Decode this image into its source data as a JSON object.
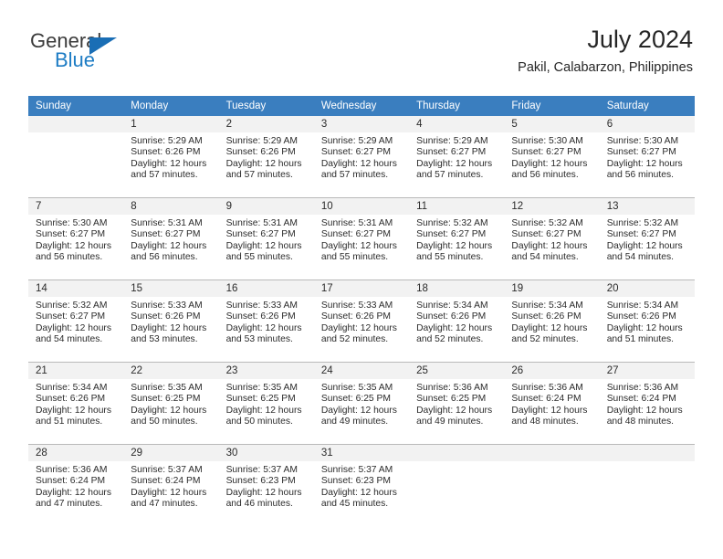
{
  "brand": {
    "line1": "General",
    "line2": "Blue",
    "flag_color": "#1a6eb5"
  },
  "header": {
    "title": "July 2024",
    "subtitle": "Pakil, Calabarzon, Philippines"
  },
  "theme": {
    "header_row_bg": "#3a7ebf",
    "daynum_bg": "#f2f2f2",
    "grid_line": "#b9b9b9",
    "text": "#2b2b2b"
  },
  "weekdays": [
    "Sunday",
    "Monday",
    "Tuesday",
    "Wednesday",
    "Thursday",
    "Friday",
    "Saturday"
  ],
  "labels": {
    "sunrise_prefix": "Sunrise:",
    "sunset_prefix": "Sunset:",
    "daylight_prefix": "Daylight:"
  },
  "weeks": [
    [
      {
        "day": "",
        "sunrise": "",
        "sunset": "",
        "daylight_line1": "",
        "daylight_line2": ""
      },
      {
        "day": "1",
        "sunrise": "Sunrise: 5:29 AM",
        "sunset": "Sunset: 6:26 PM",
        "daylight_line1": "Daylight: 12 hours",
        "daylight_line2": "and 57 minutes."
      },
      {
        "day": "2",
        "sunrise": "Sunrise: 5:29 AM",
        "sunset": "Sunset: 6:26 PM",
        "daylight_line1": "Daylight: 12 hours",
        "daylight_line2": "and 57 minutes."
      },
      {
        "day": "3",
        "sunrise": "Sunrise: 5:29 AM",
        "sunset": "Sunset: 6:27 PM",
        "daylight_line1": "Daylight: 12 hours",
        "daylight_line2": "and 57 minutes."
      },
      {
        "day": "4",
        "sunrise": "Sunrise: 5:29 AM",
        "sunset": "Sunset: 6:27 PM",
        "daylight_line1": "Daylight: 12 hours",
        "daylight_line2": "and 57 minutes."
      },
      {
        "day": "5",
        "sunrise": "Sunrise: 5:30 AM",
        "sunset": "Sunset: 6:27 PM",
        "daylight_line1": "Daylight: 12 hours",
        "daylight_line2": "and 56 minutes."
      },
      {
        "day": "6",
        "sunrise": "Sunrise: 5:30 AM",
        "sunset": "Sunset: 6:27 PM",
        "daylight_line1": "Daylight: 12 hours",
        "daylight_line2": "and 56 minutes."
      }
    ],
    [
      {
        "day": "7",
        "sunrise": "Sunrise: 5:30 AM",
        "sunset": "Sunset: 6:27 PM",
        "daylight_line1": "Daylight: 12 hours",
        "daylight_line2": "and 56 minutes."
      },
      {
        "day": "8",
        "sunrise": "Sunrise: 5:31 AM",
        "sunset": "Sunset: 6:27 PM",
        "daylight_line1": "Daylight: 12 hours",
        "daylight_line2": "and 56 minutes."
      },
      {
        "day": "9",
        "sunrise": "Sunrise: 5:31 AM",
        "sunset": "Sunset: 6:27 PM",
        "daylight_line1": "Daylight: 12 hours",
        "daylight_line2": "and 55 minutes."
      },
      {
        "day": "10",
        "sunrise": "Sunrise: 5:31 AM",
        "sunset": "Sunset: 6:27 PM",
        "daylight_line1": "Daylight: 12 hours",
        "daylight_line2": "and 55 minutes."
      },
      {
        "day": "11",
        "sunrise": "Sunrise: 5:32 AM",
        "sunset": "Sunset: 6:27 PM",
        "daylight_line1": "Daylight: 12 hours",
        "daylight_line2": "and 55 minutes."
      },
      {
        "day": "12",
        "sunrise": "Sunrise: 5:32 AM",
        "sunset": "Sunset: 6:27 PM",
        "daylight_line1": "Daylight: 12 hours",
        "daylight_line2": "and 54 minutes."
      },
      {
        "day": "13",
        "sunrise": "Sunrise: 5:32 AM",
        "sunset": "Sunset: 6:27 PM",
        "daylight_line1": "Daylight: 12 hours",
        "daylight_line2": "and 54 minutes."
      }
    ],
    [
      {
        "day": "14",
        "sunrise": "Sunrise: 5:32 AM",
        "sunset": "Sunset: 6:27 PM",
        "daylight_line1": "Daylight: 12 hours",
        "daylight_line2": "and 54 minutes."
      },
      {
        "day": "15",
        "sunrise": "Sunrise: 5:33 AM",
        "sunset": "Sunset: 6:26 PM",
        "daylight_line1": "Daylight: 12 hours",
        "daylight_line2": "and 53 minutes."
      },
      {
        "day": "16",
        "sunrise": "Sunrise: 5:33 AM",
        "sunset": "Sunset: 6:26 PM",
        "daylight_line1": "Daylight: 12 hours",
        "daylight_line2": "and 53 minutes."
      },
      {
        "day": "17",
        "sunrise": "Sunrise: 5:33 AM",
        "sunset": "Sunset: 6:26 PM",
        "daylight_line1": "Daylight: 12 hours",
        "daylight_line2": "and 52 minutes."
      },
      {
        "day": "18",
        "sunrise": "Sunrise: 5:34 AM",
        "sunset": "Sunset: 6:26 PM",
        "daylight_line1": "Daylight: 12 hours",
        "daylight_line2": "and 52 minutes."
      },
      {
        "day": "19",
        "sunrise": "Sunrise: 5:34 AM",
        "sunset": "Sunset: 6:26 PM",
        "daylight_line1": "Daylight: 12 hours",
        "daylight_line2": "and 52 minutes."
      },
      {
        "day": "20",
        "sunrise": "Sunrise: 5:34 AM",
        "sunset": "Sunset: 6:26 PM",
        "daylight_line1": "Daylight: 12 hours",
        "daylight_line2": "and 51 minutes."
      }
    ],
    [
      {
        "day": "21",
        "sunrise": "Sunrise: 5:34 AM",
        "sunset": "Sunset: 6:26 PM",
        "daylight_line1": "Daylight: 12 hours",
        "daylight_line2": "and 51 minutes."
      },
      {
        "day": "22",
        "sunrise": "Sunrise: 5:35 AM",
        "sunset": "Sunset: 6:25 PM",
        "daylight_line1": "Daylight: 12 hours",
        "daylight_line2": "and 50 minutes."
      },
      {
        "day": "23",
        "sunrise": "Sunrise: 5:35 AM",
        "sunset": "Sunset: 6:25 PM",
        "daylight_line1": "Daylight: 12 hours",
        "daylight_line2": "and 50 minutes."
      },
      {
        "day": "24",
        "sunrise": "Sunrise: 5:35 AM",
        "sunset": "Sunset: 6:25 PM",
        "daylight_line1": "Daylight: 12 hours",
        "daylight_line2": "and 49 minutes."
      },
      {
        "day": "25",
        "sunrise": "Sunrise: 5:36 AM",
        "sunset": "Sunset: 6:25 PM",
        "daylight_line1": "Daylight: 12 hours",
        "daylight_line2": "and 49 minutes."
      },
      {
        "day": "26",
        "sunrise": "Sunrise: 5:36 AM",
        "sunset": "Sunset: 6:24 PM",
        "daylight_line1": "Daylight: 12 hours",
        "daylight_line2": "and 48 minutes."
      },
      {
        "day": "27",
        "sunrise": "Sunrise: 5:36 AM",
        "sunset": "Sunset: 6:24 PM",
        "daylight_line1": "Daylight: 12 hours",
        "daylight_line2": "and 48 minutes."
      }
    ],
    [
      {
        "day": "28",
        "sunrise": "Sunrise: 5:36 AM",
        "sunset": "Sunset: 6:24 PM",
        "daylight_line1": "Daylight: 12 hours",
        "daylight_line2": "and 47 minutes."
      },
      {
        "day": "29",
        "sunrise": "Sunrise: 5:37 AM",
        "sunset": "Sunset: 6:24 PM",
        "daylight_line1": "Daylight: 12 hours",
        "daylight_line2": "and 47 minutes."
      },
      {
        "day": "30",
        "sunrise": "Sunrise: 5:37 AM",
        "sunset": "Sunset: 6:23 PM",
        "daylight_line1": "Daylight: 12 hours",
        "daylight_line2": "and 46 minutes."
      },
      {
        "day": "31",
        "sunrise": "Sunrise: 5:37 AM",
        "sunset": "Sunset: 6:23 PM",
        "daylight_line1": "Daylight: 12 hours",
        "daylight_line2": "and 45 minutes."
      },
      {
        "day": "",
        "sunrise": "",
        "sunset": "",
        "daylight_line1": "",
        "daylight_line2": ""
      },
      {
        "day": "",
        "sunrise": "",
        "sunset": "",
        "daylight_line1": "",
        "daylight_line2": ""
      },
      {
        "day": "",
        "sunrise": "",
        "sunset": "",
        "daylight_line1": "",
        "daylight_line2": ""
      }
    ]
  ]
}
